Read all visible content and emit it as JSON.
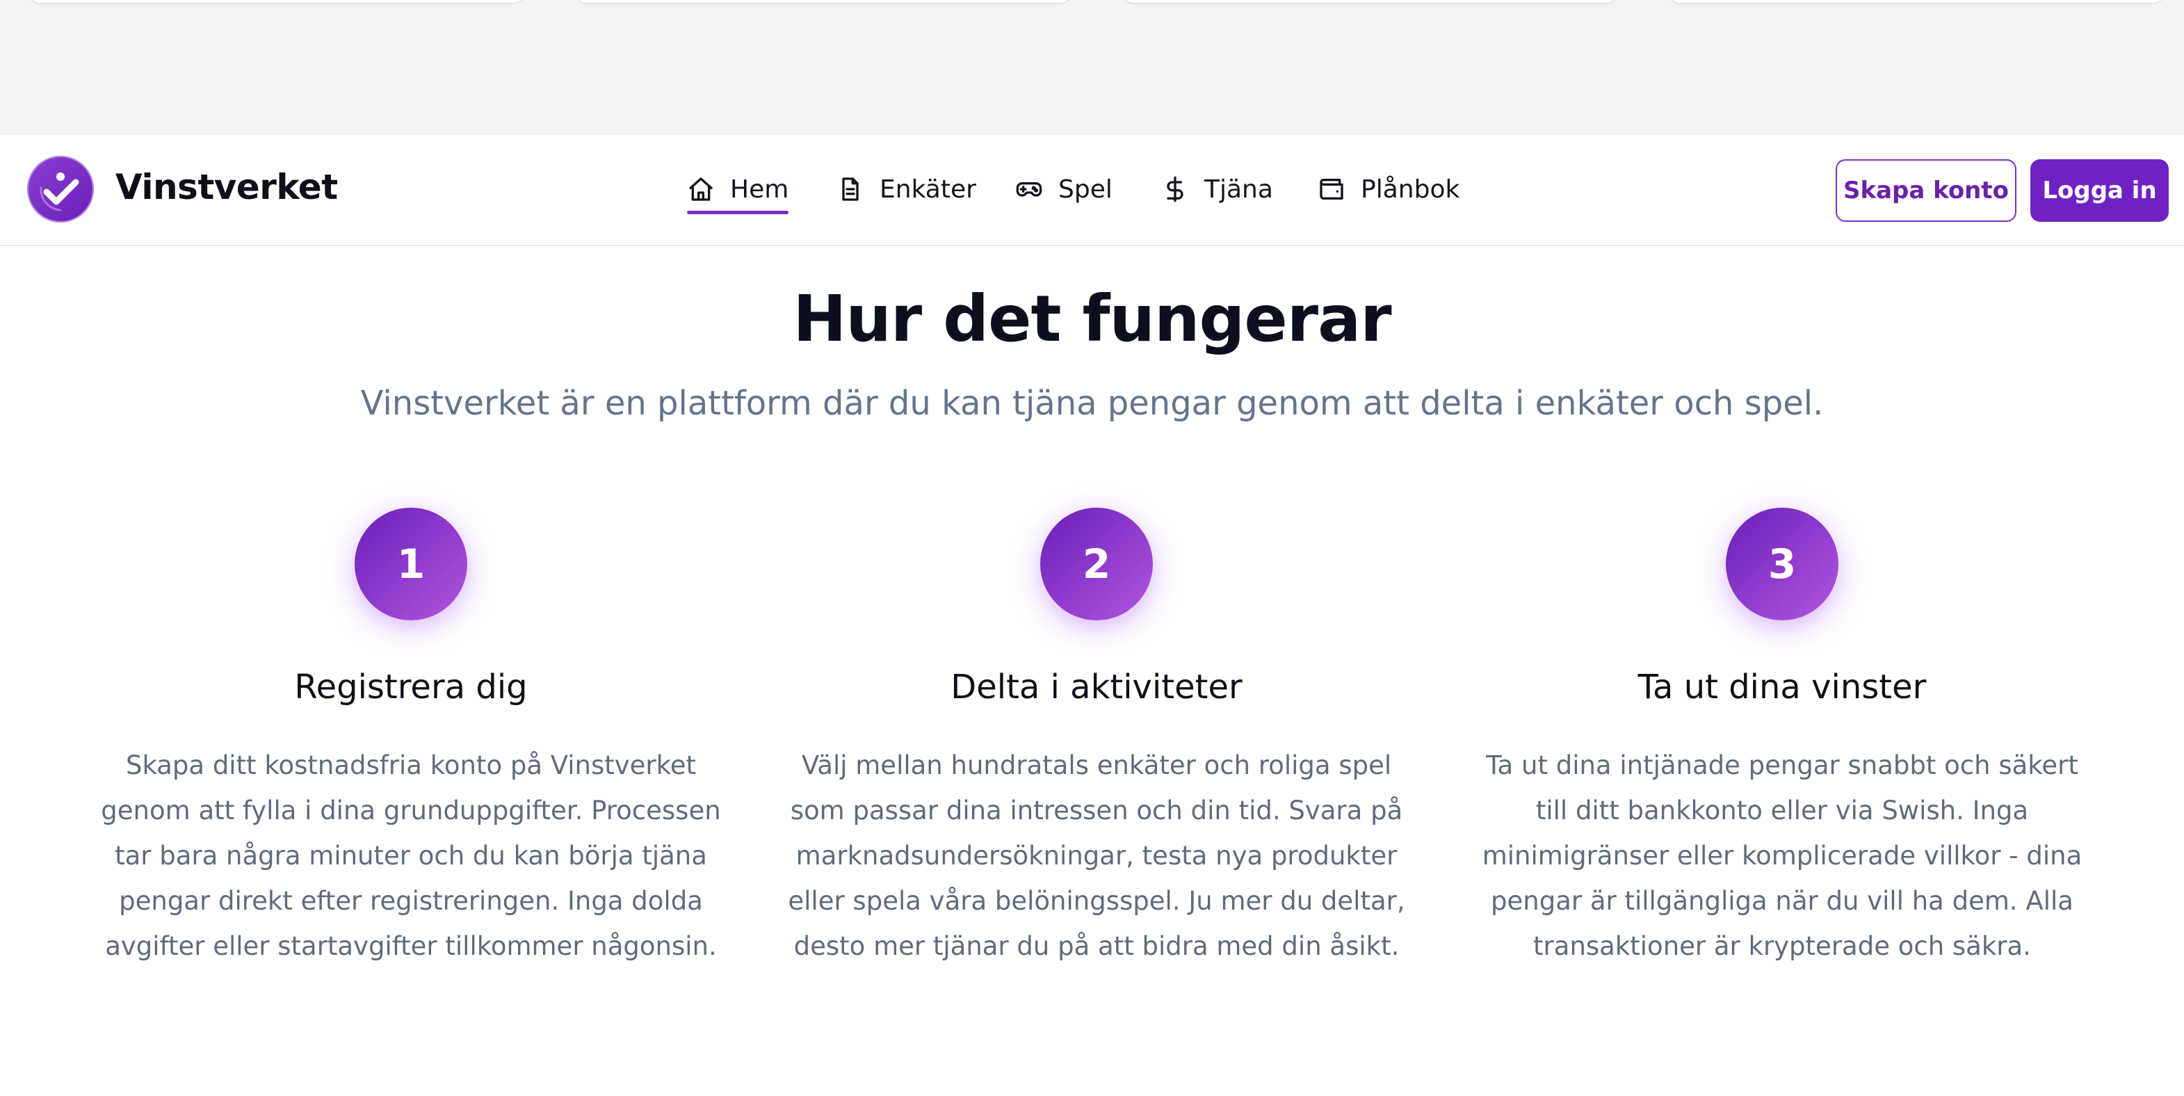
{
  "brand": {
    "name": "Vinstverket",
    "accent": "#6f22c4",
    "logo_icon": "check-logo-icon"
  },
  "nav": {
    "items": [
      {
        "label": "Hem",
        "icon": "home-icon",
        "active": true
      },
      {
        "label": "Enkäter",
        "icon": "document-icon",
        "active": false
      },
      {
        "label": "Spel",
        "icon": "gamepad-icon",
        "active": false
      },
      {
        "label": "Tjäna",
        "icon": "dollar-icon",
        "active": false
      },
      {
        "label": "Plånbok",
        "icon": "wallet-icon",
        "active": false
      }
    ],
    "create_account": "Skapa konto",
    "login": "Logga in"
  },
  "how": {
    "title": "Hur det fungerar",
    "subtitle": "Vinstverket är en plattform där du kan tjäna pengar genom att delta i enkäter och spel.",
    "steps": [
      {
        "number": "1",
        "title": "Registrera dig",
        "description": "Skapa ditt kostnadsfria konto på Vinstverket genom att fylla i dina grunduppgifter. Processen tar bara några minuter och du kan börja tjäna pengar direkt efter registreringen. Inga dolda avgifter eller startavgifter tillkommer någonsin."
      },
      {
        "number": "2",
        "title": "Delta i aktiviteter",
        "description": "Välj mellan hundratals enkäter och roliga spel som passar dina intressen och din tid. Svara på marknadsundersökningar, testa nya produkter eller spela våra belöningsspel. Ju mer du deltar, desto mer tjänar du på att bidra med din åsikt."
      },
      {
        "number": "3",
        "title": "Ta ut dina vinster",
        "description": "Ta ut dina intjänade pengar snabbt och säkert till ditt bankkonto eller via Swish. Inga minimigränser eller komplicerade villkor - dina pengar är tillgängliga när du vill ha dem. Alla transaktioner är krypterade och säkra."
      }
    ]
  }
}
